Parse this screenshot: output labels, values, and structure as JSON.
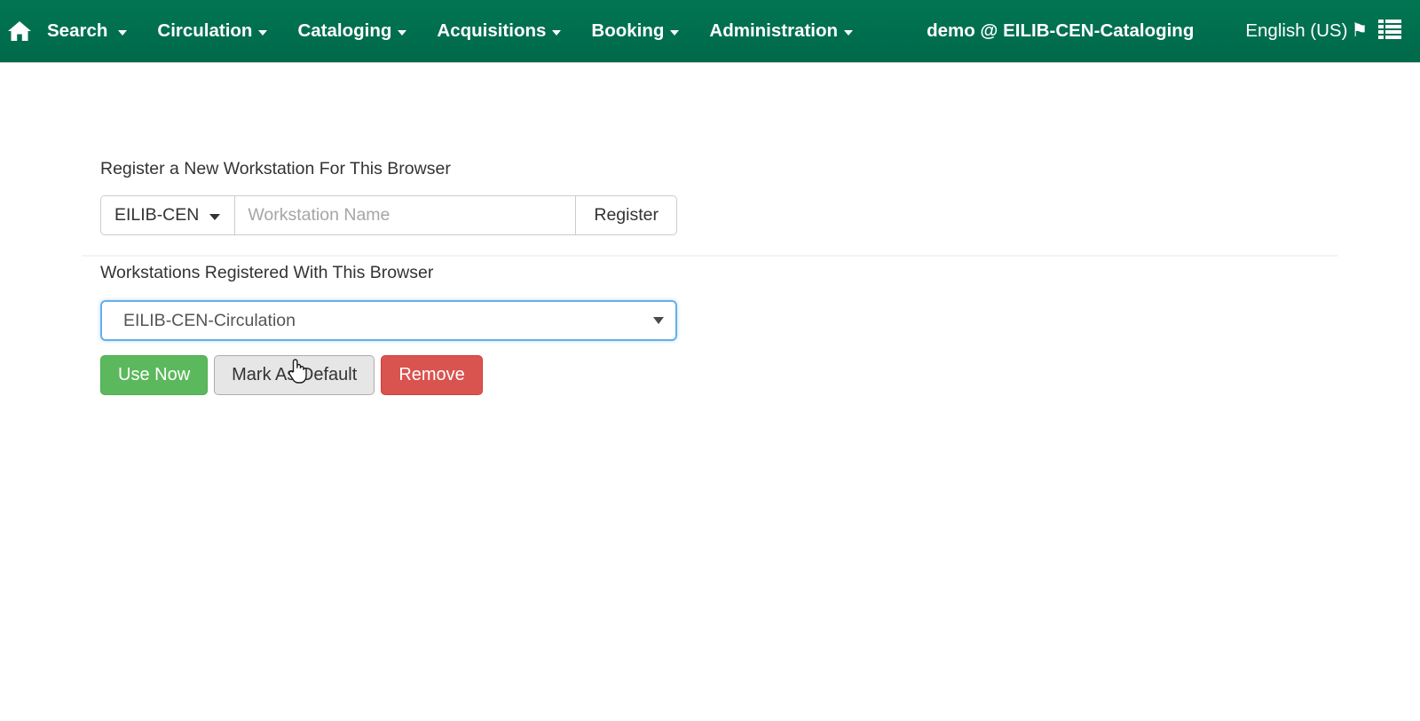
{
  "navbar": {
    "home_icon": "home-icon",
    "menus": [
      {
        "label": "Search",
        "has_caret": true
      },
      {
        "label": "Circulation",
        "has_caret": true
      },
      {
        "label": "Cataloging",
        "has_caret": true
      },
      {
        "label": "Acquisitions",
        "has_caret": true
      },
      {
        "label": "Booking",
        "has_caret": true
      },
      {
        "label": "Administration",
        "has_caret": true
      }
    ],
    "user": "demo @ EILIB-CEN-Cataloging",
    "language": "English (US)",
    "flag_icon": "flag-icon",
    "list_icon": "list-icon"
  },
  "register": {
    "heading": "Register a New Workstation For This Browser",
    "org_unit": "EILIB-CEN",
    "name_placeholder": "Workstation Name",
    "name_value": "",
    "submit_label": "Register"
  },
  "registered": {
    "heading": "Workstations Registered With This Browser",
    "selected": "EILIB-CEN-Circulation",
    "options": [
      "EILIB-CEN-Circulation"
    ],
    "use_now_label": "Use Now",
    "mark_default_label": "Mark As Default",
    "remove_label": "Remove"
  },
  "colors": {
    "navbar_green": "#017552",
    "success_green": "#5cb85c",
    "danger_red": "#d9534f",
    "default_gray": "#e6e6e6",
    "focus_blue": "#66afe9"
  }
}
